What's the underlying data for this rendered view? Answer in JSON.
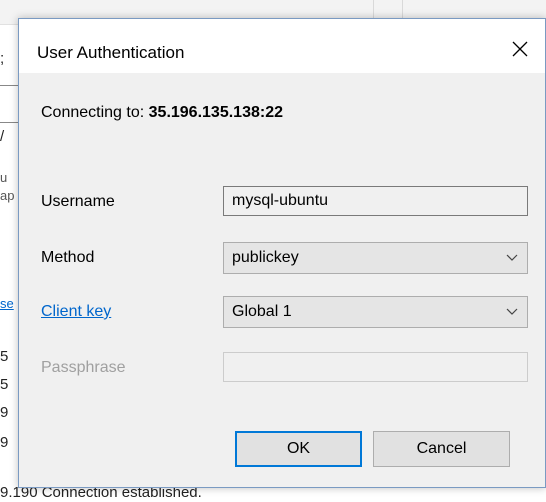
{
  "background": {
    "fragments": [
      ";",
      "/",
      "u",
      "ap",
      "se",
      "5",
      "5",
      "9",
      "9"
    ],
    "status_line": "9.190  Connection established."
  },
  "dialog": {
    "title": "User Authentication",
    "connecting_prefix": "Connecting to:",
    "connecting_host": "35.196.135.138:22",
    "fields": {
      "username_label": "Username",
      "username_value": "mysql-ubuntu",
      "method_label": "Method",
      "method_value": "publickey",
      "client_key_label": "Client key",
      "client_key_value": "Global 1",
      "passphrase_label": "Passphrase",
      "passphrase_value": ""
    },
    "buttons": {
      "ok": "OK",
      "cancel": "Cancel"
    }
  },
  "colors": {
    "accent": "#0078d7",
    "link": "#0066cc",
    "dialog_bg": "#f0f0f0"
  },
  "icons": {
    "close": "close-icon",
    "dropdown": "chevron-down-icon"
  }
}
